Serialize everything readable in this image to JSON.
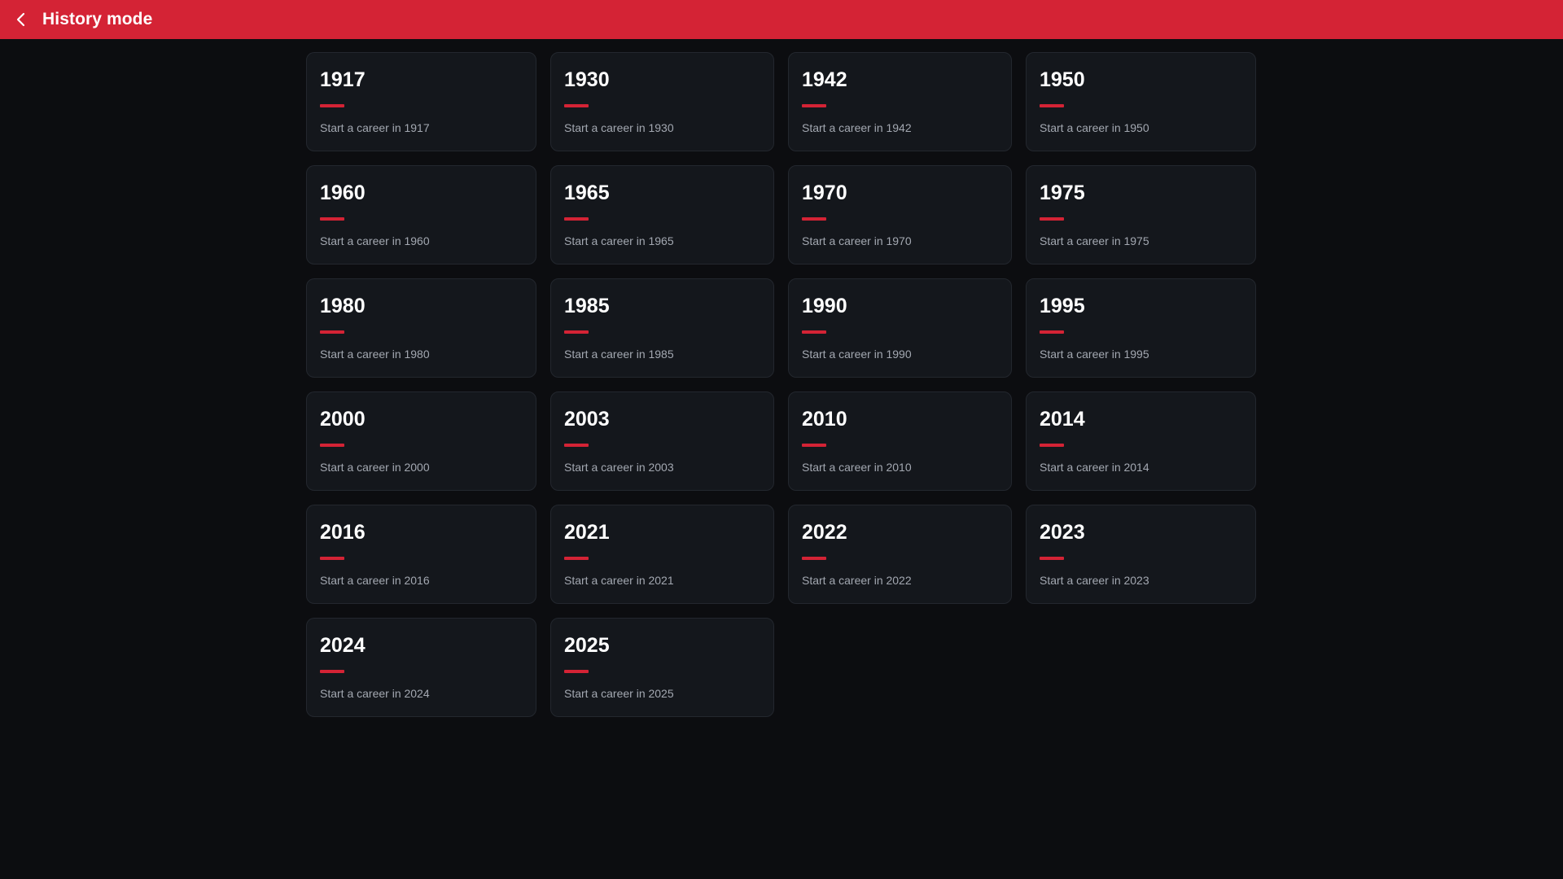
{
  "header": {
    "title": "History mode",
    "back_icon": "chevron-left-icon"
  },
  "colors": {
    "accent": "#d42335",
    "background": "#0c0d10",
    "card": "#14171c",
    "card_border": "#23272e",
    "subtitle": "#a3a8b1"
  },
  "cards": [
    {
      "year": "1917",
      "subtitle": "Start a career in 1917"
    },
    {
      "year": "1930",
      "subtitle": "Start a career in 1930"
    },
    {
      "year": "1942",
      "subtitle": "Start a career in 1942"
    },
    {
      "year": "1950",
      "subtitle": "Start a career in 1950"
    },
    {
      "year": "1960",
      "subtitle": "Start a career in 1960"
    },
    {
      "year": "1965",
      "subtitle": "Start a career in 1965"
    },
    {
      "year": "1970",
      "subtitle": "Start a career in 1970"
    },
    {
      "year": "1975",
      "subtitle": "Start a career in 1975"
    },
    {
      "year": "1980",
      "subtitle": "Start a career in 1980"
    },
    {
      "year": "1985",
      "subtitle": "Start a career in 1985"
    },
    {
      "year": "1990",
      "subtitle": "Start a career in 1990"
    },
    {
      "year": "1995",
      "subtitle": "Start a career in 1995"
    },
    {
      "year": "2000",
      "subtitle": "Start a career in 2000"
    },
    {
      "year": "2003",
      "subtitle": "Start a career in 2003"
    },
    {
      "year": "2010",
      "subtitle": "Start a career in 2010"
    },
    {
      "year": "2014",
      "subtitle": "Start a career in 2014"
    },
    {
      "year": "2016",
      "subtitle": "Start a career in 2016"
    },
    {
      "year": "2021",
      "subtitle": "Start a career in 2021"
    },
    {
      "year": "2022",
      "subtitle": "Start a career in 2022"
    },
    {
      "year": "2023",
      "subtitle": "Start a career in 2023"
    },
    {
      "year": "2024",
      "subtitle": "Start a career in 2024"
    },
    {
      "year": "2025",
      "subtitle": "Start a career in 2025"
    }
  ]
}
